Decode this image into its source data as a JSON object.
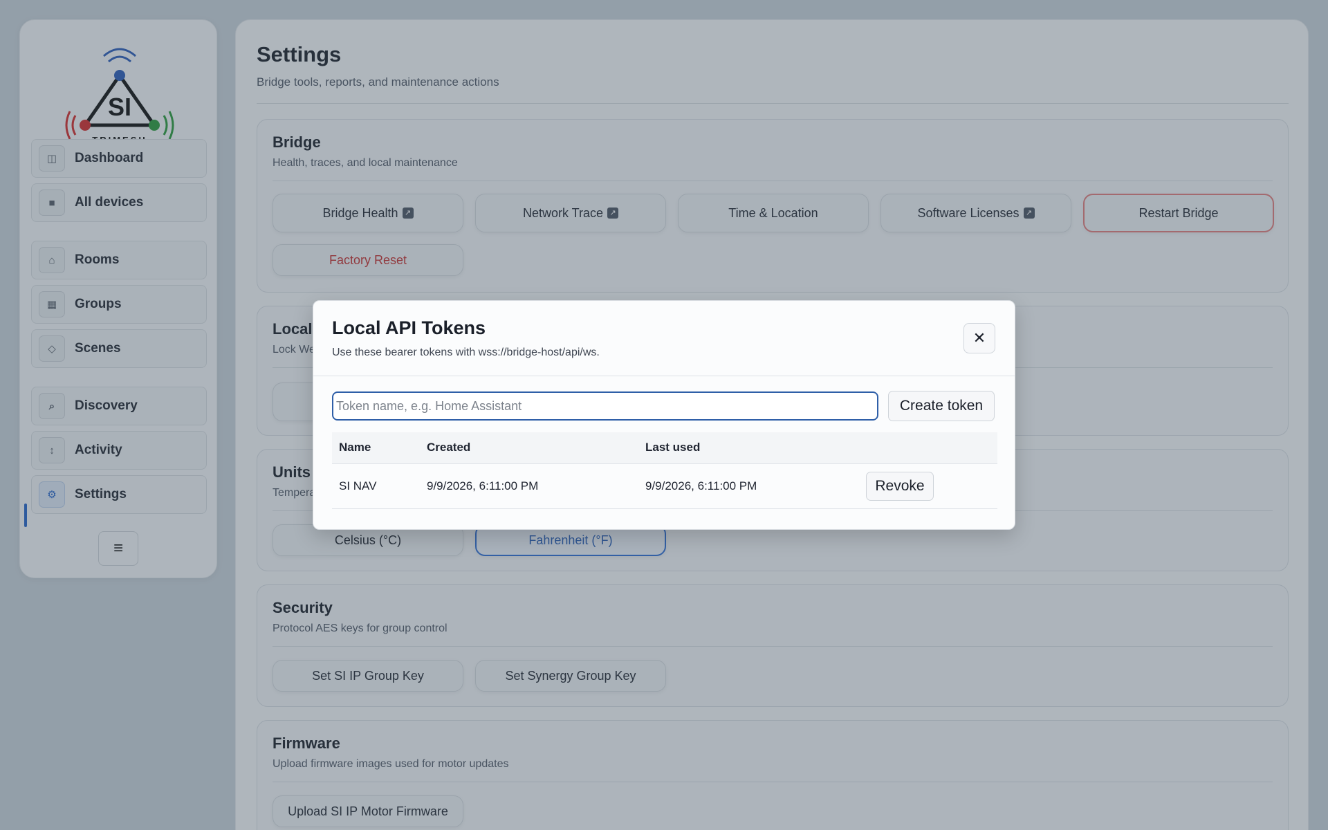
{
  "brand": {
    "logo_text": "SI",
    "logo_subtext": "TRIMESH"
  },
  "sidebar": {
    "items": [
      {
        "label": "Dashboard",
        "icon": "dashboard-icon",
        "glyph": "◫"
      },
      {
        "label": "All devices",
        "icon": "devices-icon",
        "glyph": "■"
      },
      {
        "label": "Rooms",
        "icon": "home-icon",
        "glyph": "⌂"
      },
      {
        "label": "Groups",
        "icon": "groups-icon",
        "glyph": "▦"
      },
      {
        "label": "Scenes",
        "icon": "diamond-icon",
        "glyph": "◇"
      },
      {
        "label": "Discovery",
        "icon": "search-icon",
        "glyph": "⌕"
      },
      {
        "label": "Activity",
        "icon": "arrows-vertical-icon",
        "glyph": "↕"
      },
      {
        "label": "Settings",
        "icon": "gear-icon",
        "glyph": "⚙"
      }
    ],
    "active": "Settings",
    "menu_glyph": "≡"
  },
  "page": {
    "title": "Settings",
    "subtitle": "Bridge tools, reports, and maintenance actions"
  },
  "sections": {
    "bridge": {
      "title": "Bridge",
      "subtitle": "Health, traces, and local maintenance",
      "buttons": [
        "Bridge Health",
        "Network Trace",
        "Time & Location",
        "Software Licenses",
        "Restart Bridge",
        "Factory Reset"
      ]
    },
    "local": {
      "title": "Local",
      "subtitle": "Lock We"
    },
    "units": {
      "title": "Units",
      "subtitle": "Tempera",
      "options": [
        "Celsius (°C)",
        "Fahrenheit (°F)"
      ],
      "selected": "Fahrenheit (°F)"
    },
    "security": {
      "title": "Security",
      "subtitle": "Protocol AES keys for group control",
      "buttons": [
        "Set SI IP Group Key",
        "Set Synergy Group Key"
      ]
    },
    "firmware": {
      "title": "Firmware",
      "subtitle": "Upload firmware images used for motor updates",
      "buttons": [
        "Upload SI IP Motor Firmware"
      ]
    }
  },
  "modal": {
    "title": "Local API Tokens",
    "subtitle": "Use these bearer tokens with wss://bridge-host/api/ws.",
    "close_glyph": "✕",
    "input_placeholder": "Token name, e.g. Home Assistant",
    "input_value": "",
    "create_label": "Create token",
    "columns": [
      "Name",
      "Created",
      "Last used"
    ],
    "rows": [
      {
        "name": "SI NAV",
        "created": "9/9/2026, 6:11:00 PM",
        "last_used": "9/9/2026, 6:11:00 PM",
        "action": "Revoke"
      }
    ]
  },
  "colors": {
    "accent": "#2563c9",
    "danger": "#c62f2f",
    "overlay": "rgba(60,75,90,0.38)"
  }
}
